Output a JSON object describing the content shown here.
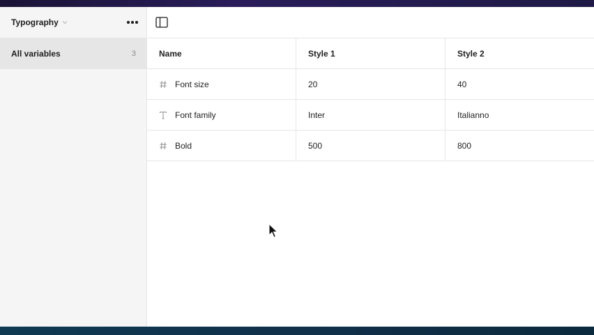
{
  "sidebar": {
    "collection_title": "Typography",
    "groups": [
      {
        "label": "All variables",
        "count": "3"
      }
    ]
  },
  "table": {
    "headers": [
      "Name",
      "Style 1",
      "Style 2"
    ],
    "rows": [
      {
        "icon": "number-icon",
        "name": "Font size",
        "style1": "20",
        "style2": "40"
      },
      {
        "icon": "text-type-icon",
        "name": "Font family",
        "style1": "Inter",
        "style2": "Italianno"
      },
      {
        "icon": "number-icon",
        "name": "Bold",
        "style1": "500",
        "style2": "800"
      }
    ]
  },
  "icons": {
    "more": "more-horizontal-icon",
    "panel_toggle": "sidebar-toggle-icon",
    "chevron": "chevron-down-icon",
    "cursor": "mouse-cursor-icon"
  },
  "colors": {
    "sidebar_bg": "#f5f5f5",
    "selected_row_bg": "#e6e6e6",
    "border": "#e6e6e6",
    "text": "#1e1e1e",
    "muted": "#8c8c8c"
  }
}
